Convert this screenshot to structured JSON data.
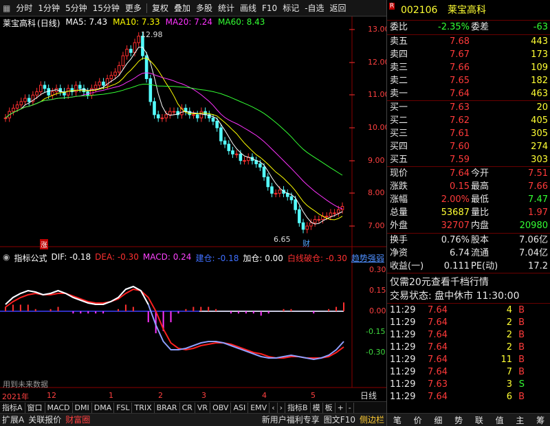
{
  "toolbar": {
    "timeframes": [
      "分时",
      "1分钟",
      "5分钟",
      "15分钟",
      "更多"
    ],
    "tools": [
      "复权",
      "叠加",
      "多股",
      "统计",
      "画线",
      "F10",
      "标记",
      "-自选",
      "返回"
    ]
  },
  "main_chart": {
    "stock_title": "莱宝高科",
    "period": "(日线)",
    "ma": [
      {
        "label": "MA5: 7.43",
        "color": "#ffffff"
      },
      {
        "label": "MA10: 7.33",
        "color": "#ffff00"
      },
      {
        "label": "MA20: 7.24",
        "color": "#ff33ff"
      },
      {
        "label": "MA60: 8.43",
        "color": "#33ff33"
      }
    ],
    "y_ticks": [
      "13.00",
      "12.00",
      "11.00",
      "10.00",
      "9.00",
      "8.00",
      "7.00"
    ],
    "high_marker": "12.98",
    "low_marker": "6.65",
    "zhang_marker": "涨",
    "cai_marker": "财"
  },
  "indicator": {
    "name": "指标公式",
    "dif": "DIF: -0.18",
    "dea": "DEA: -0.30",
    "macd": "MACD: 0.24",
    "jiancang": "建仓: -0.18",
    "jiacang": "加仓: 0.00",
    "bailinjiancang": "白线破仓: -0.30",
    "trend": "趋势强弱",
    "y_ticks": [
      "0.30",
      "0.15",
      "0.00",
      "-0.15",
      "-0.30"
    ],
    "future_note": "用到未来数据"
  },
  "x_axis": {
    "labels": [
      "2021年",
      "12",
      "1",
      "2",
      "3",
      "4",
      "5"
    ],
    "right_label": "日线"
  },
  "tabs": [
    "指标A",
    "窗口",
    "MACD",
    "DMI",
    "DMA",
    "FSL",
    "TRIX",
    "BRAR",
    "CR",
    "VR",
    "OBV",
    "ASI",
    "EMV"
  ],
  "tabs_right": [
    "指标B",
    "模",
    "板",
    "+",
    "-"
  ],
  "bottom": {
    "left": [
      "扩展A",
      "关联报价",
      "财富圈"
    ],
    "right": [
      "新用户福利专享",
      "图文F10",
      "侧边栏"
    ],
    "panel_tabs": [
      "笔",
      "价",
      "细",
      "势",
      "联",
      "值",
      "主",
      "筹"
    ]
  },
  "quote": {
    "code": "002106",
    "name": "莱宝高科",
    "weibi_label": "委比",
    "weibi": "-2.35%",
    "weicha_label": "委差",
    "weicha": "-63",
    "sells": [
      {
        "label": "卖五",
        "price": "7.68",
        "vol": "443"
      },
      {
        "label": "卖四",
        "price": "7.67",
        "vol": "173"
      },
      {
        "label": "卖三",
        "price": "7.66",
        "vol": "109"
      },
      {
        "label": "卖二",
        "price": "7.65",
        "vol": "182"
      },
      {
        "label": "卖一",
        "price": "7.64",
        "vol": "463"
      }
    ],
    "buys": [
      {
        "label": "买一",
        "price": "7.63",
        "vol": "20"
      },
      {
        "label": "买二",
        "price": "7.62",
        "vol": "405"
      },
      {
        "label": "买三",
        "price": "7.61",
        "vol": "305"
      },
      {
        "label": "买四",
        "price": "7.60",
        "vol": "274"
      },
      {
        "label": "买五",
        "price": "7.59",
        "vol": "303"
      }
    ],
    "stats": [
      {
        "l1": "现价",
        "v1": "7.64",
        "c1": "red",
        "l2": "今开",
        "v2": "7.51",
        "c2": "red"
      },
      {
        "l1": "涨跌",
        "v1": "0.15",
        "c1": "red",
        "l2": "最高",
        "v2": "7.66",
        "c2": "red"
      },
      {
        "l1": "涨幅",
        "v1": "2.00%",
        "c1": "red",
        "l2": "最低",
        "v2": "7.47",
        "c2": "grn"
      },
      {
        "l1": "总量",
        "v1": "53687",
        "c1": "yel",
        "l2": "量比",
        "v2": "1.97",
        "c2": "red"
      },
      {
        "l1": "外盘",
        "v1": "32707",
        "c1": "red",
        "l2": "内盘",
        "v2": "20980",
        "c2": "grn"
      }
    ],
    "stats2": [
      {
        "l1": "换手",
        "v1": "0.76%",
        "l2": "股本",
        "v2": "7.06亿"
      },
      {
        "l1": "净资",
        "v1": "6.74",
        "l2": "流通",
        "v2": "7.04亿"
      },
      {
        "l1": "收益(一)",
        "v1": "0.111",
        "l2": "PE(动)",
        "v2": "17.2"
      }
    ],
    "promo": "仅需20元查看千档行情",
    "status": "交易状态: 盘中休市 11:30:00",
    "ticks": [
      {
        "t": "11:29",
        "p": "7.64",
        "v": "4",
        "s": "B"
      },
      {
        "t": "11:29",
        "p": "7.64",
        "v": "2",
        "s": "B"
      },
      {
        "t": "11:29",
        "p": "7.64",
        "v": "2",
        "s": "B"
      },
      {
        "t": "11:29",
        "p": "7.64",
        "v": "2",
        "s": "B"
      },
      {
        "t": "11:29",
        "p": "7.64",
        "v": "11",
        "s": "B"
      },
      {
        "t": "11:29",
        "p": "7.64",
        "v": "7",
        "s": "B"
      },
      {
        "t": "11:29",
        "p": "7.63",
        "v": "3",
        "s": "S"
      },
      {
        "t": "11:29",
        "p": "7.64",
        "v": "6",
        "s": "B"
      }
    ]
  }
}
